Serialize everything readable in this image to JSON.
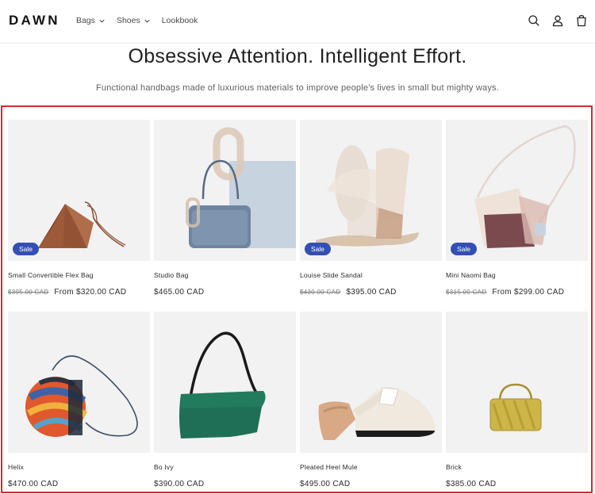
{
  "store": {
    "logo": "DAWN",
    "nav": [
      {
        "label": "Bags",
        "has_dropdown": true
      },
      {
        "label": "Shoes",
        "has_dropdown": true
      },
      {
        "label": "Lookbook",
        "has_dropdown": false
      }
    ],
    "icons": [
      "search-icon",
      "account-icon",
      "cart-icon"
    ]
  },
  "hero": {
    "title": "Obsessive Attention. Intelligent Effort.",
    "subtitle": "Functional handbags made of luxurious materials to improve people's lives in small but mighty ways."
  },
  "products": [
    {
      "name": "Small Convertible Flex Bag",
      "badge": "Sale",
      "compare_price": "$395.00 CAD",
      "price": "From $320.00 CAD"
    },
    {
      "name": "Studio Bag",
      "badge": "",
      "compare_price": "",
      "price": "$465.00 CAD"
    },
    {
      "name": "Louise Slide Sandal",
      "badge": "Sale",
      "compare_price": "$430.00 CAD",
      "price": "$395.00 CAD"
    },
    {
      "name": "Mini Naomi Bag",
      "badge": "Sale",
      "compare_price": "$315.00 CAD",
      "price": "From $299.00 CAD"
    },
    {
      "name": "Helix",
      "badge": "",
      "compare_price": "",
      "price": "$470.00 CAD"
    },
    {
      "name": "Bo Ivy",
      "badge": "",
      "compare_price": "",
      "price": "$390.00 CAD"
    },
    {
      "name": "Pleated Heel Mule",
      "badge": "",
      "compare_price": "",
      "price": "$495.00 CAD"
    },
    {
      "name": "Brick",
      "badge": "",
      "compare_price": "",
      "price": "$385.00 CAD"
    }
  ],
  "colors": {
    "sale_badge": "#334fb4",
    "highlight_frame": "#d02c2f",
    "image_bg": "#f2f2f2"
  }
}
